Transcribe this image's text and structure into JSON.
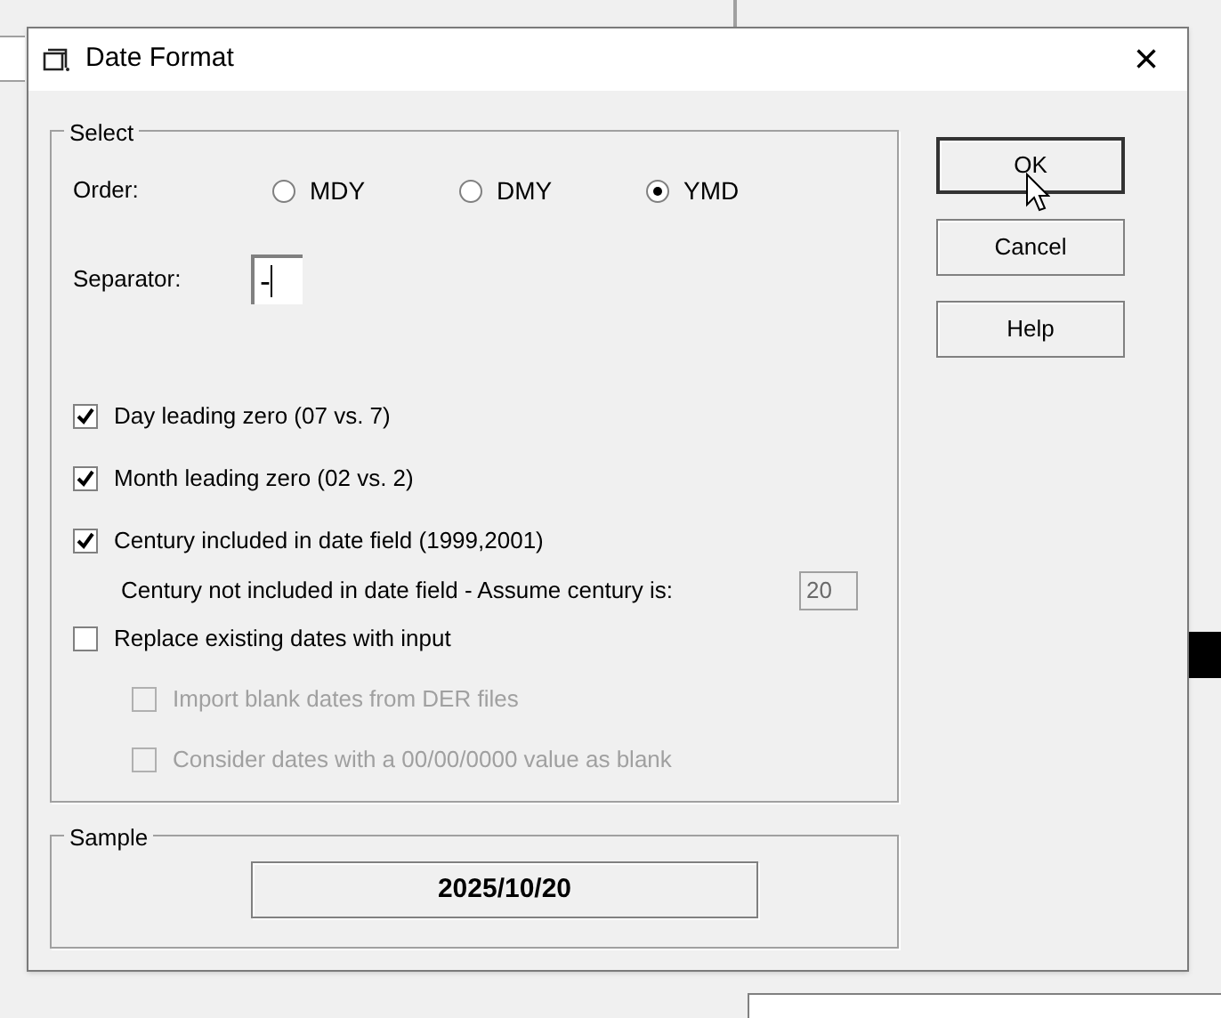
{
  "window": {
    "title": "Date Format",
    "close": "×"
  },
  "select_group": {
    "title": "Select",
    "order": {
      "label": "Order:",
      "options": [
        {
          "label": "MDY",
          "selected": false
        },
        {
          "label": "DMY",
          "selected": false
        },
        {
          "label": "YMD",
          "selected": true
        }
      ]
    },
    "separator": {
      "label": "Separator:",
      "value": "-"
    },
    "options": [
      {
        "label": "Day leading zero (07 vs. 7)",
        "checked": true,
        "disabled": false
      },
      {
        "label": "Month leading zero (02  vs. 2)",
        "checked": true,
        "disabled": false
      },
      {
        "label": "Century included in date field (1999,2001)",
        "checked": true,
        "disabled": false
      },
      {
        "kind": "century",
        "label": "Century not included in date field - Assume century is:",
        "value": "20",
        "disabled": true
      },
      {
        "label": "Replace existing dates with input",
        "checked": false,
        "disabled": false,
        "children": [
          {
            "label": "Import blank dates from DER files",
            "checked": false,
            "disabled": true
          },
          {
            "label": "Consider dates with a 00/00/0000 value as blank",
            "checked": false,
            "disabled": true
          }
        ]
      }
    ]
  },
  "sample_group": {
    "title": "Sample",
    "value": "2025/10/20"
  },
  "buttons": [
    {
      "label": "OK",
      "default": true
    },
    {
      "label": "Cancel",
      "default": false
    },
    {
      "label": "Help",
      "default": false
    }
  ]
}
